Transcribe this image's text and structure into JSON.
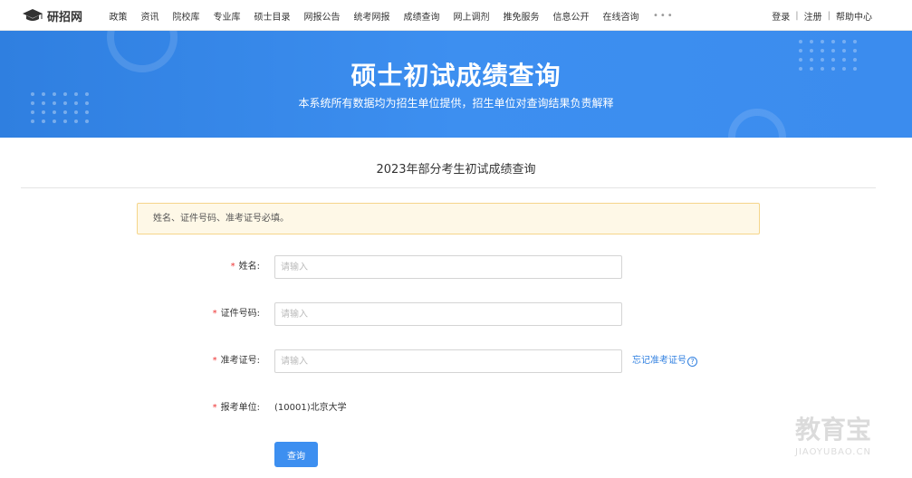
{
  "topnav": {
    "logo_text": "研招网",
    "items": [
      "政策",
      "资讯",
      "院校库",
      "专业库",
      "硕士目录",
      "网报公告",
      "统考网报",
      "成绩查询",
      "网上调剂",
      "推免服务",
      "信息公开",
      "在线咨询"
    ],
    "more": "•••",
    "login": "登录",
    "register": "注册",
    "help": "帮助中心",
    "separator": "|"
  },
  "banner": {
    "title": "硕士初试成绩查询",
    "subtitle": "本系统所有数据均为招生单位提供，招生单位对查询结果负责解释"
  },
  "main": {
    "heading": "2023年部分考生初试成绩查询",
    "notice": "姓名、证件号码、准考证号必填。",
    "required_mark": "*",
    "fields": [
      {
        "label": "姓名:",
        "placeholder": "请输入",
        "value": ""
      },
      {
        "label": "证件号码:",
        "placeholder": "请输入",
        "value": ""
      },
      {
        "label": "准考证号:",
        "placeholder": "请输入",
        "value": ""
      }
    ],
    "forgot_link": "忘记准考证号",
    "forgot_icon": "?",
    "school_label": "报考单位:",
    "school_value": "(10001)北京大学",
    "submit_label": "查询"
  },
  "watermark": {
    "text": "教育宝",
    "url": "JIAOYUBAO.CN"
  },
  "colors": {
    "primary": "#3d8ff0",
    "banner": "#2f7fe0",
    "required": "#ee3333",
    "notice_bg": "#fef8e7",
    "notice_border": "#f5d58a"
  }
}
